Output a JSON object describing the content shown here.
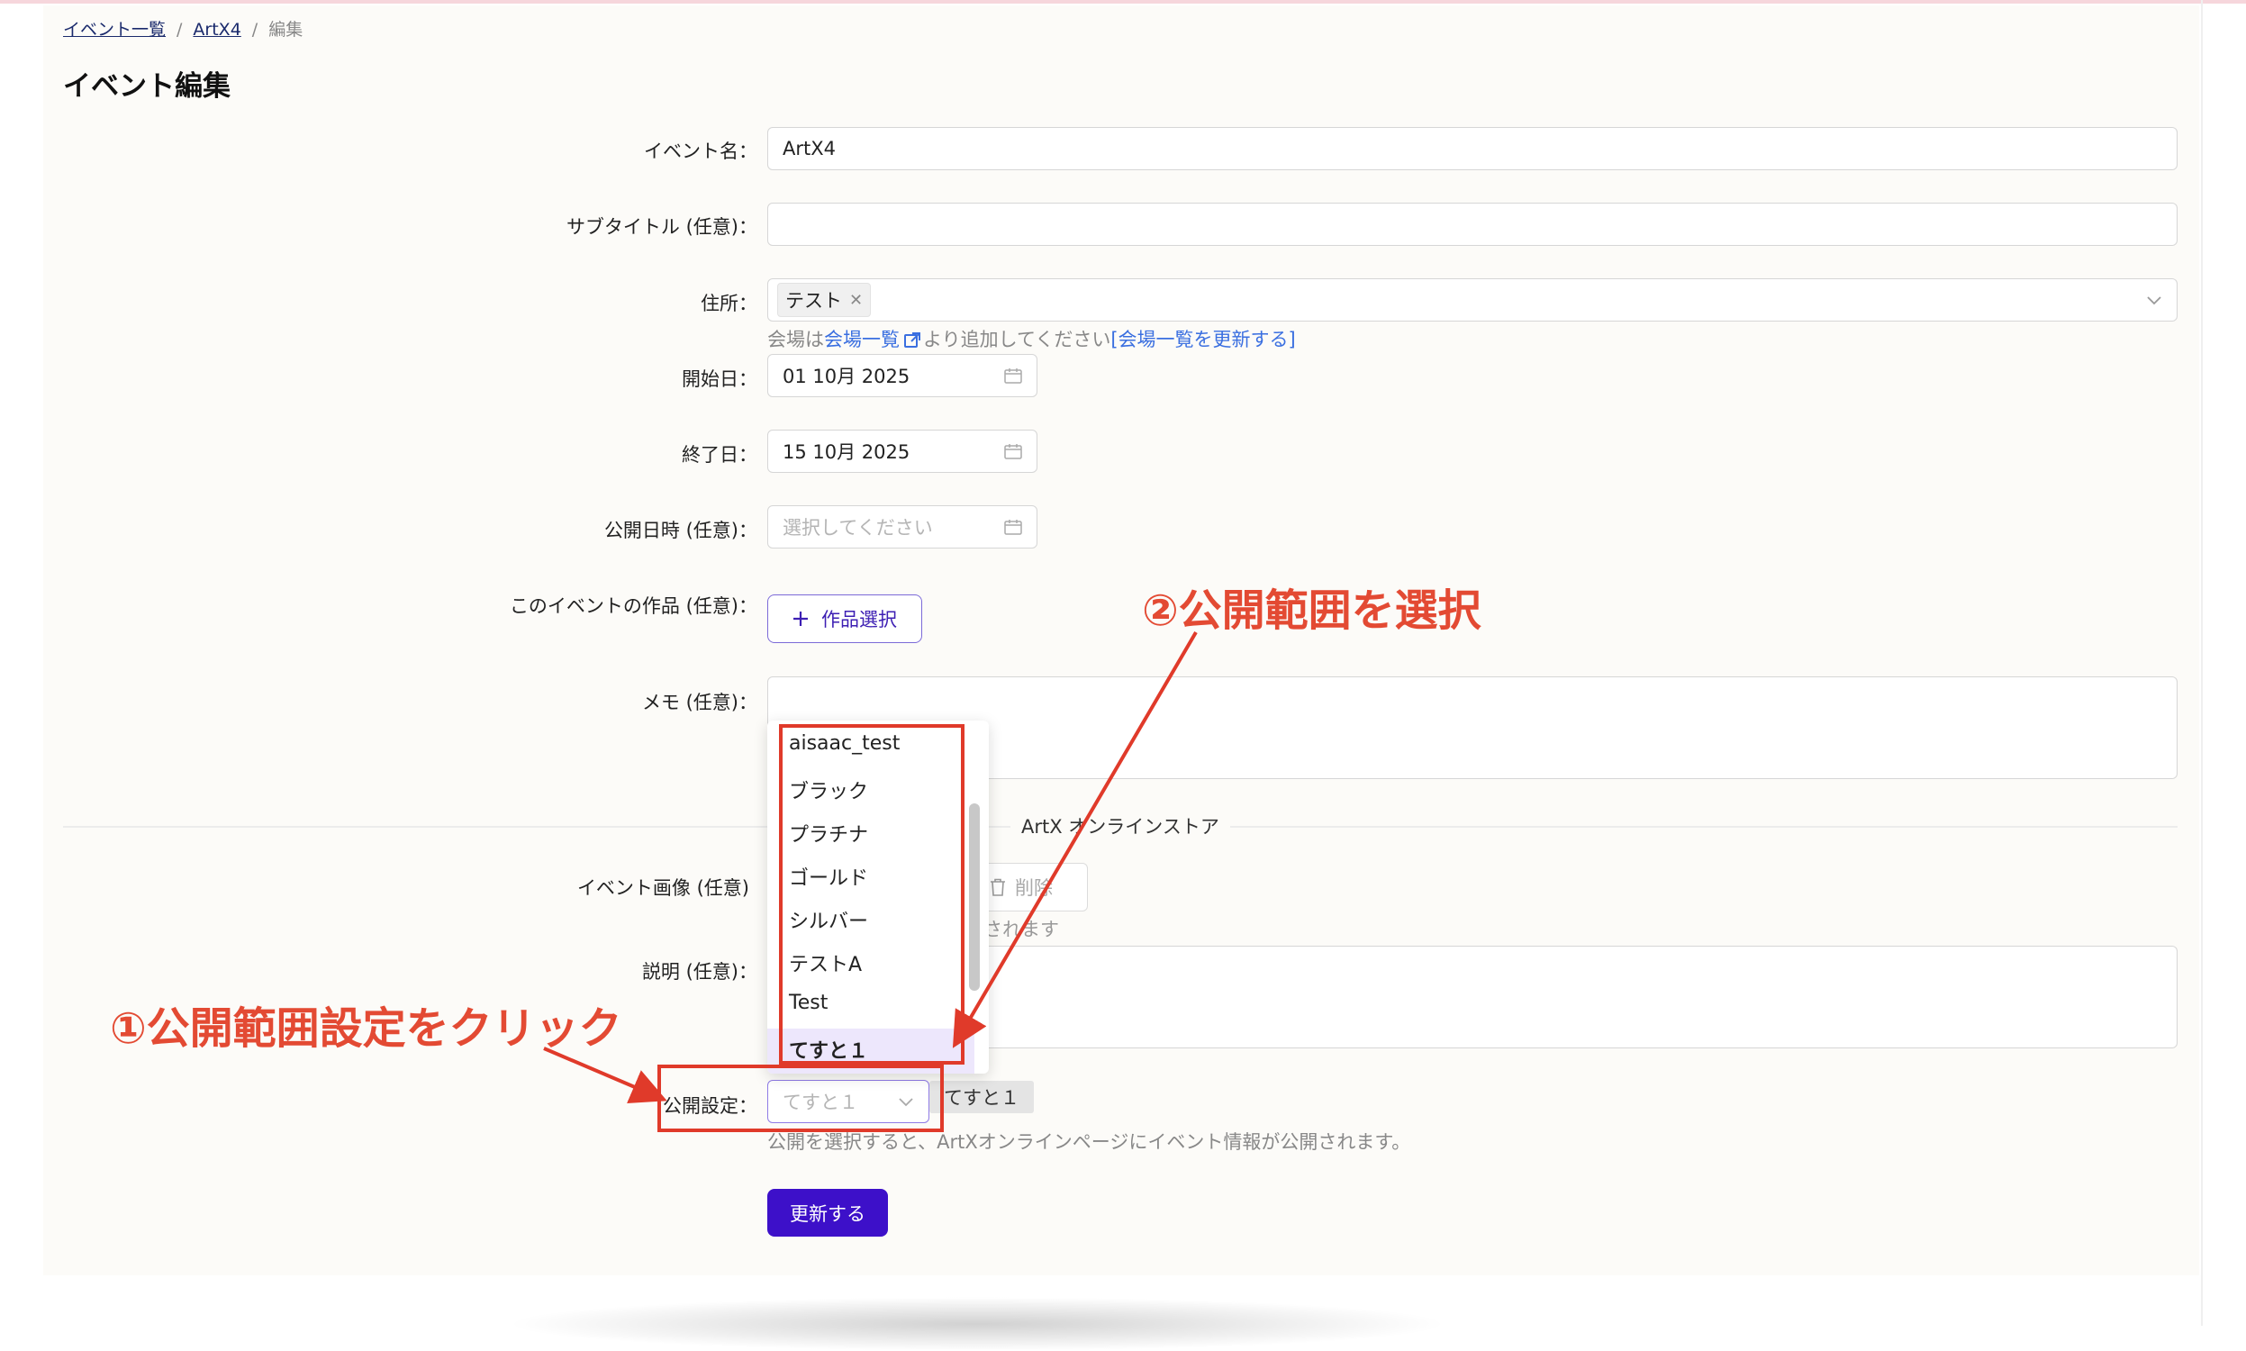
{
  "breadcrumb": {
    "item1": "イベント一覧",
    "item2": "ArtX4",
    "current": "編集",
    "sep": "/"
  },
  "page": {
    "title": "イベント編集"
  },
  "form": {
    "event_name": {
      "label": "イベント名：",
      "value": "ArtX4"
    },
    "subtitle": {
      "label": "サブタイトル (任意)：",
      "value": ""
    },
    "address": {
      "label": "住所：",
      "tag": "テスト",
      "help_prefix": "会場は",
      "help_link": "会場一覧",
      "help_middle": "より追加してください",
      "help_refresh": "[会場一覧を更新する]"
    },
    "start_date": {
      "label": "開始日：",
      "value": "01 10月 2025"
    },
    "end_date": {
      "label": "終了日：",
      "value": "15 10月 2025"
    },
    "publish_datetime": {
      "label": "公開日時 (任意)：",
      "placeholder": "選択してください"
    },
    "works": {
      "label": "このイベントの作品 (任意)：",
      "button": "作品選択"
    },
    "memo": {
      "label": "メモ (任意)："
    },
    "section_title": "ArtX オンラインストア",
    "event_image": {
      "label": "イベント画像 (任意)",
      "delete_button": "削除",
      "note": "されます"
    },
    "description": {
      "label": "説明 (任意)："
    },
    "publish_setting": {
      "label": "公開設定：",
      "value": "てすと１",
      "tooltip": "てすと１",
      "help": "公開を選択すると、ArtXオンラインページにイベント情報が公開されます。"
    },
    "submit": "更新する"
  },
  "dropdown": {
    "options": [
      "aisaac_test",
      "ブラック",
      "プラチナ",
      "ゴールド",
      "シルバー",
      "テストA",
      "Test",
      "てすと１"
    ],
    "selected": "てすと１"
  },
  "annotations": {
    "step1": "①公開範囲設定をクリック",
    "step2": "②公開範囲を選択"
  },
  "colors": {
    "accent": "#3d10c9",
    "annotation": "#e03a2a",
    "link": "#3a6fe0"
  }
}
